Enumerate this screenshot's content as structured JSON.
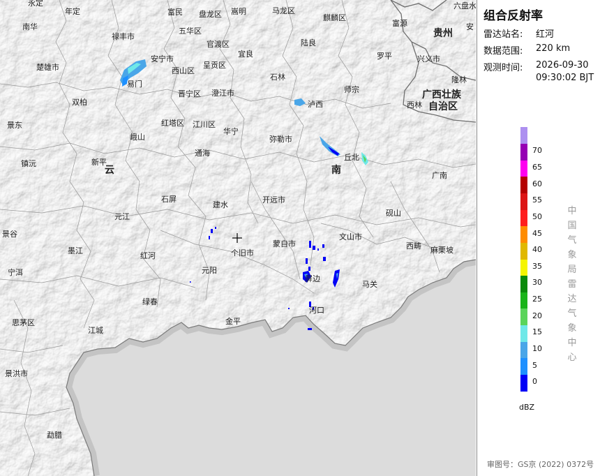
{
  "panel": {
    "title": "组合反射率",
    "station_label": "雷达站名:",
    "station_value": "红河",
    "range_label": "数据范围:",
    "range_value": "220 km",
    "time_label": "观测时间:",
    "time_value_date": "2026-09-30",
    "time_value_time": "09:30:02 BJT",
    "unit": "dBZ",
    "credit": "中国气象局雷达气象中心",
    "license": "审图号：GS京 (2022) 0372号"
  },
  "legend": [
    {
      "value": 0,
      "label": "0",
      "color": "#0000f6"
    },
    {
      "value": 5,
      "label": "5",
      "color": "#1e90ff"
    },
    {
      "value": 10,
      "label": "10",
      "color": "#4aa6e8"
    },
    {
      "value": 15,
      "label": "15",
      "color": "#6fe8e8"
    },
    {
      "value": 20,
      "label": "20",
      "color": "#5ad45a"
    },
    {
      "value": 25,
      "label": "25",
      "color": "#19b419"
    },
    {
      "value": 30,
      "label": "30",
      "color": "#0a8a0a"
    },
    {
      "value": 35,
      "label": "35",
      "color": "#f5f500"
    },
    {
      "value": 40,
      "label": "40",
      "color": "#e0b800"
    },
    {
      "value": 45,
      "label": "45",
      "color": "#ff8c00"
    },
    {
      "value": 50,
      "label": "50",
      "color": "#ff1e1e"
    },
    {
      "value": 55,
      "label": "55",
      "color": "#dc1414"
    },
    {
      "value": 60,
      "label": "60",
      "color": "#b40000"
    },
    {
      "value": 65,
      "label": "65",
      "color": "#ff00f0"
    },
    {
      "value": 70,
      "label": "70",
      "color": "#9600b4"
    },
    {
      "value": 75,
      "label": "",
      "color": "#ad90f0"
    }
  ],
  "map": {
    "land_color": "#e8e8e8",
    "outside_color": "#dcdcdc",
    "places": [
      {
        "name": "南华",
        "key": "nanhua"
      },
      {
        "name": "楚雄市",
        "key": "chuxiong"
      },
      {
        "name": "禄丰市",
        "key": "lufeng"
      },
      {
        "name": "安宁市",
        "key": "anning"
      },
      {
        "name": "易门",
        "key": "yimen"
      },
      {
        "name": "双柏",
        "key": "shuangbai"
      },
      {
        "name": "景东",
        "key": "jingdong"
      },
      {
        "name": "峨山",
        "key": "eshan"
      },
      {
        "name": "镇沅",
        "key": "zhenyuan"
      },
      {
        "name": "新平",
        "key": "xinping"
      },
      {
        "name": "元江",
        "key": "yuanjiang"
      },
      {
        "name": "景谷",
        "key": "jinggu"
      },
      {
        "name": "墨江",
        "key": "mojiang"
      },
      {
        "name": "宁洱",
        "key": "ninger"
      },
      {
        "name": "思茅区",
        "key": "simao"
      },
      {
        "name": "江城",
        "key": "jiangcheng"
      },
      {
        "name": "景洪市",
        "key": "jinghong"
      },
      {
        "name": "勐腊",
        "key": "mengla"
      },
      {
        "name": "红河",
        "key": "honghe"
      },
      {
        "name": "元阳",
        "key": "yuanyang"
      },
      {
        "name": "绿春",
        "key": "lvchun"
      },
      {
        "name": "金平",
        "key": "jinping"
      },
      {
        "name": "个旧市",
        "key": "gejiu"
      },
      {
        "name": "建水",
        "key": "jianshui"
      },
      {
        "name": "石屏",
        "key": "shiping"
      },
      {
        "name": "通海",
        "key": "tonghai"
      },
      {
        "name": "红塔区",
        "key": "hongta"
      },
      {
        "name": "江川区",
        "key": "jiangchuan"
      },
      {
        "name": "华宁",
        "key": "huaning"
      },
      {
        "name": "晋宁区",
        "key": "jinning"
      },
      {
        "name": "澄江市",
        "key": "chengjiang"
      },
      {
        "name": "西山区",
        "key": "xishan"
      },
      {
        "name": "呈贡区",
        "key": "chenggong"
      },
      {
        "name": "五华区",
        "key": "wuhua"
      },
      {
        "name": "富民",
        "key": "fumin"
      },
      {
        "name": "盘龙区",
        "key": "panlong"
      },
      {
        "name": "嵩明",
        "key": "songming"
      },
      {
        "name": "官渡区",
        "key": "guandu"
      },
      {
        "name": "宜良",
        "key": "yiliang"
      },
      {
        "name": "石林",
        "key": "shilin"
      },
      {
        "name": "马龙区",
        "key": "malong"
      },
      {
        "name": "麒麟区",
        "key": "qilin"
      },
      {
        "name": "陆良",
        "key": "luliang"
      },
      {
        "name": "富源",
        "key": "fuyuan"
      },
      {
        "name": "罗平",
        "key": "luoping"
      },
      {
        "name": "兴义市",
        "key": "xingyi"
      },
      {
        "name": "六盘水",
        "key": "liupanshui"
      },
      {
        "name": "隆林",
        "key": "longlin"
      },
      {
        "name": "师宗",
        "key": "shizong"
      },
      {
        "name": "泸西",
        "key": "luxi"
      },
      {
        "name": "弥勒市",
        "key": "mile"
      },
      {
        "name": "丘北",
        "key": "qiubei"
      },
      {
        "name": "西林",
        "key": "xilin"
      },
      {
        "name": "广南",
        "key": "guangnan"
      },
      {
        "name": "开远市",
        "key": "kaiyuan"
      },
      {
        "name": "蒙自市",
        "key": "mengzi"
      },
      {
        "name": "文山市",
        "key": "wenshan"
      },
      {
        "name": "砚山",
        "key": "yanshan"
      },
      {
        "name": "西畴",
        "key": "xichou"
      },
      {
        "name": "麻栗坡",
        "key": "malipo"
      },
      {
        "name": "马关",
        "key": "maguan"
      },
      {
        "name": "屏边",
        "key": "pingbian"
      },
      {
        "name": "河口",
        "key": "hekou"
      },
      {
        "name": "年定",
        "key": "nianding"
      },
      {
        "name": "永定",
        "key": "yongding"
      },
      {
        "name": "安",
        "key": "an"
      }
    ],
    "provinces": [
      {
        "name": "云",
        "key": "yun"
      },
      {
        "name": "南",
        "key": "nan"
      },
      {
        "name": "贵州",
        "key": "guizhou"
      },
      {
        "name": "广西壮族",
        "key": "guangxi1"
      },
      {
        "name": "自治区",
        "key": "guangxi2"
      }
    ]
  }
}
